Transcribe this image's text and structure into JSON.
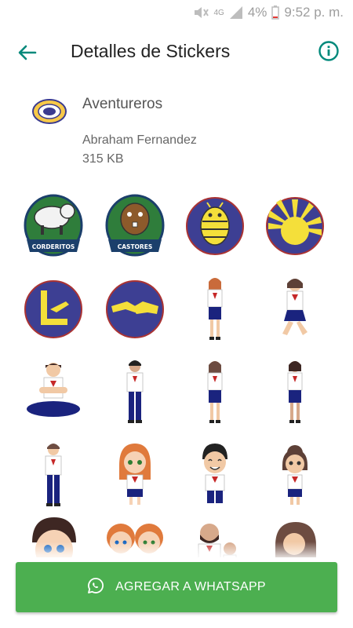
{
  "status_bar": {
    "battery_percent": "4%",
    "time": "9:52 p. m.",
    "network": "4G",
    "icons": [
      "mute-icon",
      "signal-icon",
      "battery-icon"
    ]
  },
  "app_bar": {
    "title": "Detalles de Stickers",
    "back_icon": "arrow-back-icon",
    "info_icon": "info-icon",
    "accent_color": "#00897b"
  },
  "pack": {
    "name": "Aventureros",
    "author": "Abraham Fernandez",
    "size": "315 KB"
  },
  "stickers": {
    "corderitos_label": "CORDERITOS",
    "castores_label": "CASTORES",
    "items": [
      "corderitos-sticker",
      "castores-sticker",
      "bee-sticker",
      "sun-sticker",
      "l-emblem-sticker",
      "handshake-sticker",
      "girl-standing-sticker",
      "girl-jumping-sticker",
      "boy-sitting-sticker",
      "boy-standing-sticker",
      "girl-standing-2-sticker",
      "girl-standing-3-sticker",
      "boy-standing-2-sticker",
      "redhead-girl-sticker",
      "smiling-boy-sticker",
      "curly-girl-sticker",
      "boy-face-sticker",
      "twins-sticker",
      "bearded-man-sticker",
      "woman-hug-sticker"
    ]
  },
  "action": {
    "label": "AGREGAR A WHATSAPP",
    "color": "#4caf50",
    "icon": "whatsapp-icon"
  }
}
